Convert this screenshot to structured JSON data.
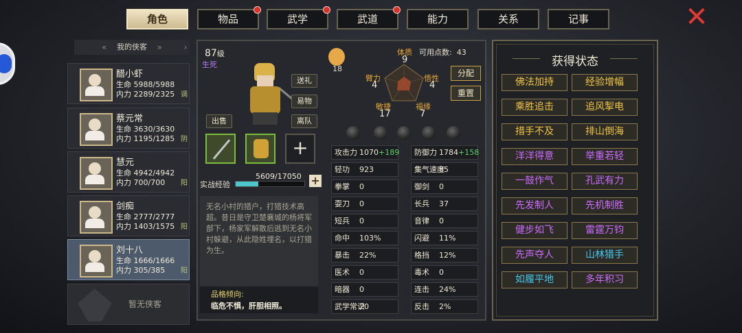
{
  "tabs": [
    {
      "label": "角色",
      "active": true,
      "dot": false
    },
    {
      "label": "物品",
      "active": false,
      "dot": true
    },
    {
      "label": "武学",
      "active": false,
      "dot": true
    },
    {
      "label": "武道",
      "active": false,
      "dot": true
    },
    {
      "label": "能力",
      "active": false,
      "dot": false
    },
    {
      "label": "关系",
      "active": false,
      "dot": false
    },
    {
      "label": "记事",
      "active": false,
      "dot": false
    }
  ],
  "close_icon": "✕",
  "roster": {
    "title": "我的侠客",
    "chevron_left": "«",
    "chevron_right": "»",
    "scroll": "›",
    "members": [
      {
        "name": "醋小虾",
        "hp": "生命 5988/5988",
        "mp": "内力 2289/2325",
        "tag": "调"
      },
      {
        "name": "蔡元常",
        "hp": "生命 3630/3630",
        "mp": "内力 1195/1285",
        "tag": "阴"
      },
      {
        "name": "慧元",
        "hp": "生命 4942/4942",
        "mp": "内力 700/700",
        "tag": "阳"
      },
      {
        "name": "剑痴",
        "hp": "生命 2777/2777",
        "mp": "内力 1403/1575",
        "tag": "阳"
      },
      {
        "name": "刘十八",
        "hp": "生命 1666/1666",
        "mp": "内力 305/385",
        "tag": "阳"
      }
    ],
    "empty_label": "暂无侠客"
  },
  "character": {
    "level": "87",
    "level_unit": "级",
    "status": "生死",
    "buttons": {
      "gift": "送礼",
      "trade": "易物",
      "leave": "离队",
      "sell": "出售"
    },
    "exp_label": "实战经验",
    "exp_text": "5609/17050",
    "exp_fraction": 0.329,
    "exp_plus": "+",
    "slot_plus": "+",
    "description": "无名小村的猎户，打猎技术高超。昔日是守卫楚襄城的杨将军部下，杨家军解散后逃到无名小村躲避，从此隐姓埋名，以打猎为生。",
    "trait_title": "品格倾向:",
    "trait_text": "临危不惧，肝胆相照。"
  },
  "attributes": {
    "walk_value": "18",
    "points_label": "可用点数:",
    "points_value": "43",
    "assign": "分配",
    "reset": "重置",
    "pentagon": [
      {
        "name": "体质",
        "value": "9"
      },
      {
        "name": "臂力",
        "value": "4"
      },
      {
        "name": "悟性",
        "value": "4"
      },
      {
        "name": "敏捷",
        "value": "17"
      },
      {
        "name": "福缘",
        "value": "7"
      }
    ]
  },
  "stats_left": [
    {
      "label": "攻击力",
      "value": "1070",
      "bonus": "+189"
    },
    {
      "label": "轻功",
      "value": "923",
      "bonus": ""
    },
    {
      "label": "拳掌",
      "value": "0",
      "bonus": ""
    },
    {
      "label": "耍刀",
      "value": "0",
      "bonus": ""
    },
    {
      "label": "短兵",
      "value": "0",
      "bonus": ""
    },
    {
      "label": "命中",
      "value": "103%",
      "bonus": ""
    },
    {
      "label": "暴击",
      "value": "22%",
      "bonus": ""
    },
    {
      "label": "医术",
      "value": "0",
      "bonus": ""
    },
    {
      "label": "暗器",
      "value": "0",
      "bonus": ""
    },
    {
      "label": "武学常识",
      "value": "20",
      "bonus": ""
    }
  ],
  "stats_right": [
    {
      "label": "防御力",
      "value": "1784",
      "bonus": "+158"
    },
    {
      "label": "集气速度",
      "value": "85",
      "bonus": ""
    },
    {
      "label": "御剑",
      "value": "0",
      "bonus": ""
    },
    {
      "label": "长兵",
      "value": "37",
      "bonus": ""
    },
    {
      "label": "音律",
      "value": "0",
      "bonus": ""
    },
    {
      "label": "闪避",
      "value": "11%",
      "bonus": ""
    },
    {
      "label": "格挡",
      "value": "12%",
      "bonus": ""
    },
    {
      "label": "毒术",
      "value": "0",
      "bonus": ""
    },
    {
      "label": "连击",
      "value": "24%",
      "bonus": ""
    },
    {
      "label": "反击",
      "value": "2%",
      "bonus": ""
    }
  ],
  "status_panel": {
    "title": "获得状态",
    "items": [
      {
        "label": "佛法加持",
        "color": "#f2c644"
      },
      {
        "label": "经验增幅",
        "color": "#f2c644"
      },
      {
        "label": "乘胜追击",
        "color": "#f2c644"
      },
      {
        "label": "追风掣电",
        "color": "#f2c644"
      },
      {
        "label": "措手不及",
        "color": "#f2c644"
      },
      {
        "label": "排山倒海",
        "color": "#f2c644"
      },
      {
        "label": "洋洋得意",
        "color": "#cc6cff"
      },
      {
        "label": "举重若轻",
        "color": "#cc6cff"
      },
      {
        "label": "一鼓作气",
        "color": "#cc6cff"
      },
      {
        "label": "孔武有力",
        "color": "#cc6cff"
      },
      {
        "label": "先发制人",
        "color": "#cc6cff"
      },
      {
        "label": "先机制胜",
        "color": "#cc6cff"
      },
      {
        "label": "健步如飞",
        "color": "#cc6cff"
      },
      {
        "label": "雷霆万钧",
        "color": "#cc6cff"
      },
      {
        "label": "先声夺人",
        "color": "#cc6cff"
      },
      {
        "label": "山林猎手",
        "color": "#46c8f0"
      },
      {
        "label": "如履平地",
        "color": "#46c8f0"
      },
      {
        "label": "多年积习",
        "color": "#cc6cff"
      }
    ]
  }
}
